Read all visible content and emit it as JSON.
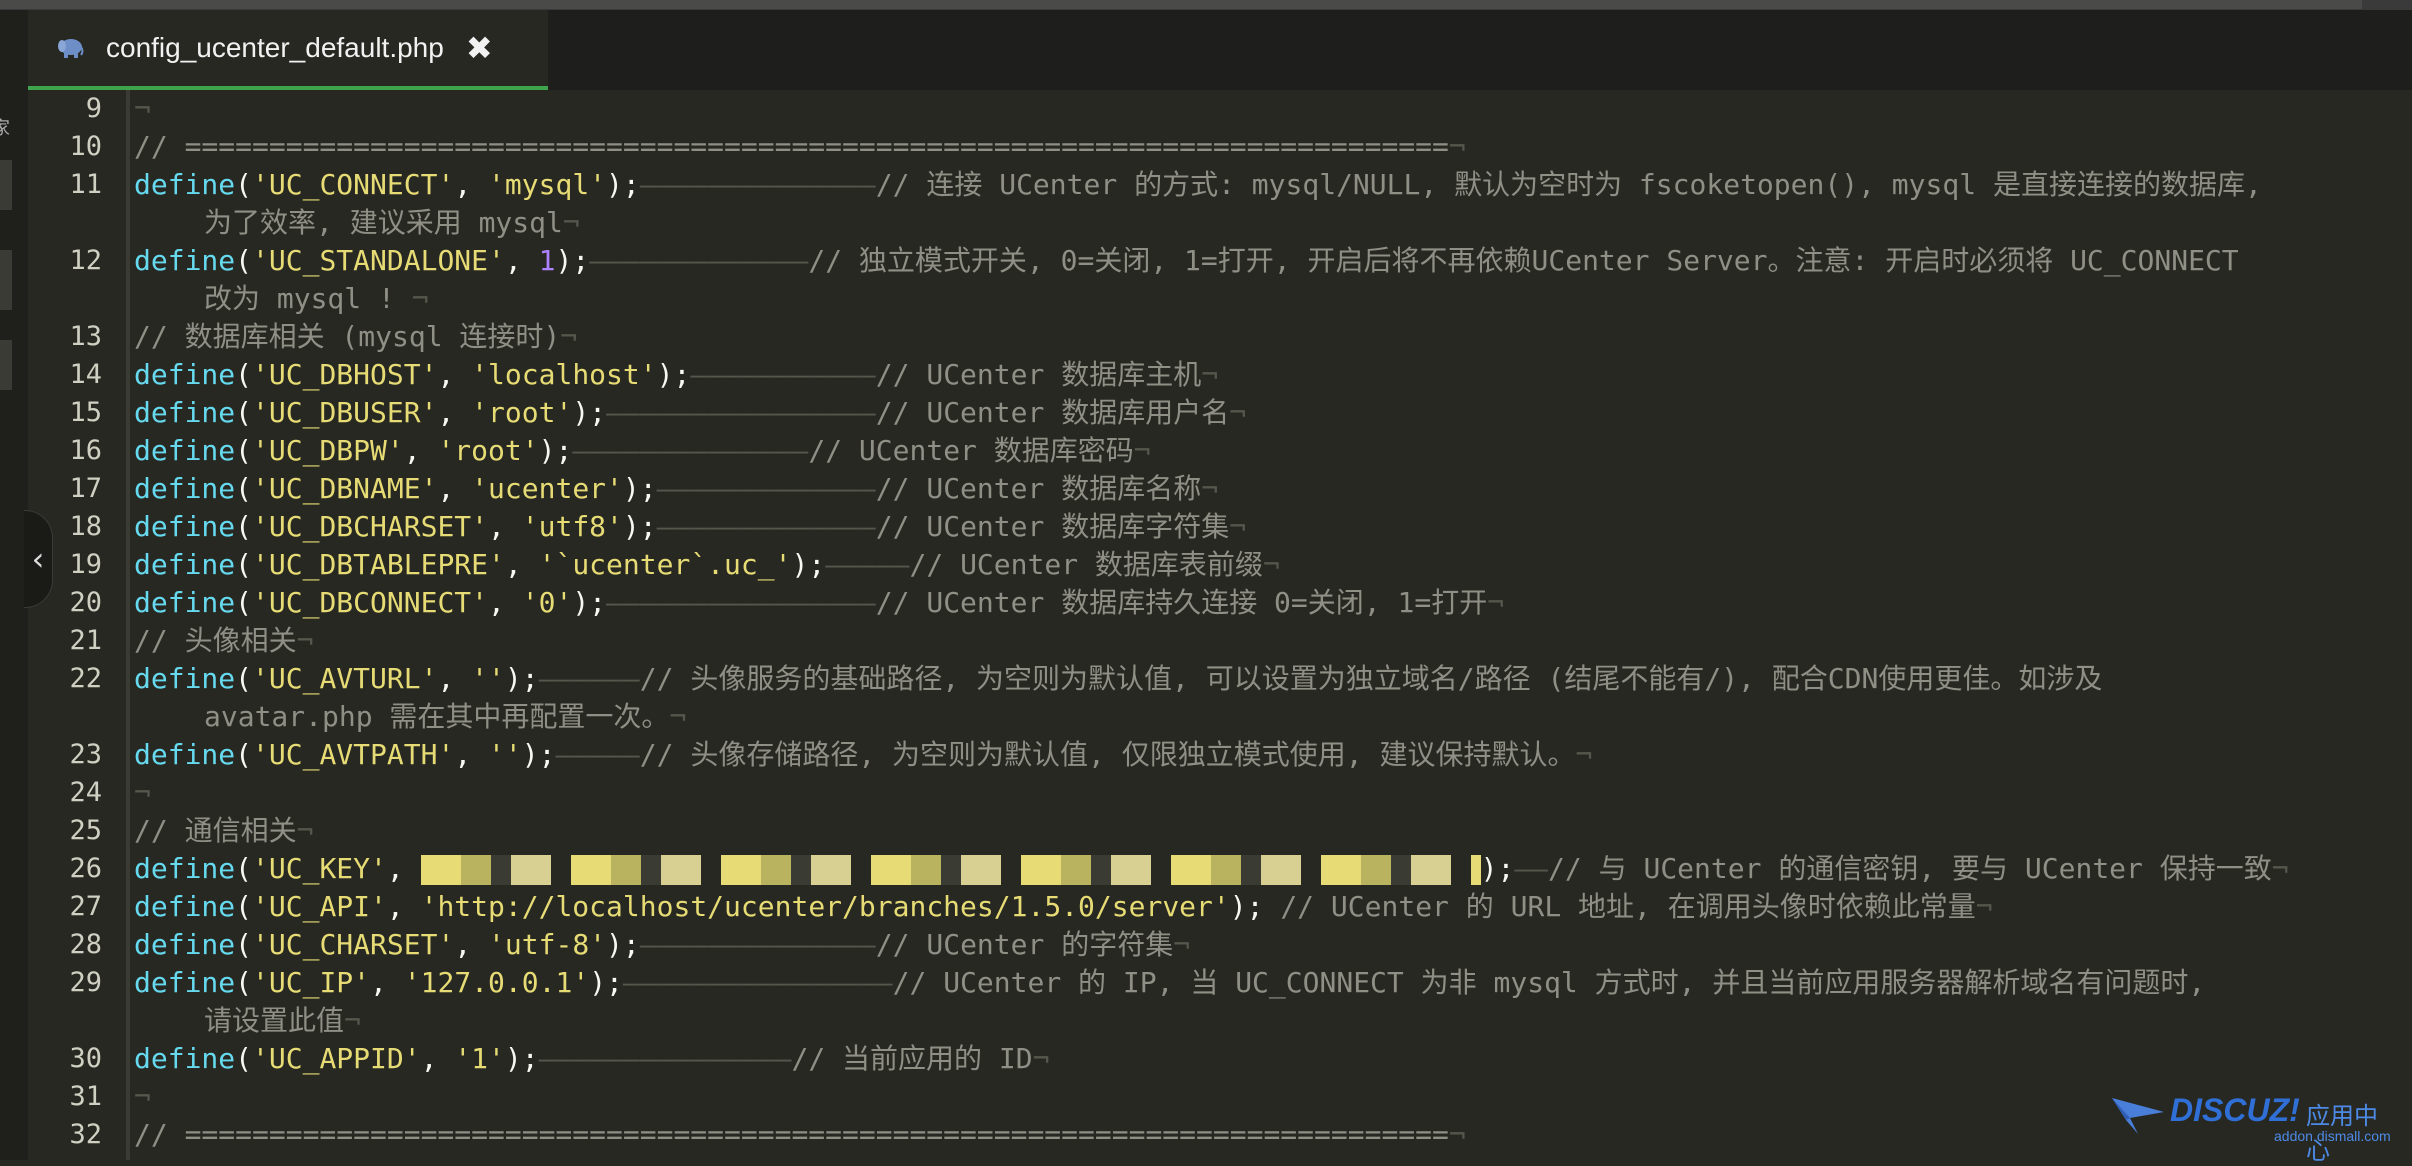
{
  "tab": {
    "title": "config_ucenter_default.php",
    "close_glyph": "✖",
    "icon": "php-elephant-icon"
  },
  "sidebar": {
    "collapse_glyph": "‹",
    "edge_glyph": "家"
  },
  "colors": {
    "keyword": "#66d9ef",
    "string": "#e6db74",
    "number": "#ae81ff",
    "comment": "#8f8f86",
    "background": "#272822",
    "tab_accent": "#3ea34a"
  },
  "lines": [
    {
      "num": "9",
      "tokens": [
        {
          "t": "nl",
          "v": "¬"
        }
      ]
    },
    {
      "num": "10",
      "tokens": [
        {
          "t": "c",
          "v": "// ==========================================================================="
        },
        {
          "t": "nl",
          "v": "¬"
        }
      ]
    },
    {
      "num": "11",
      "tokens": [
        {
          "t": "k",
          "v": "define"
        },
        {
          "t": "p",
          "v": "("
        },
        {
          "t": "s",
          "v": "'UC_CONNECT'"
        },
        {
          "t": "p",
          "v": ", "
        },
        {
          "t": "s",
          "v": "'mysql'"
        },
        {
          "t": "p",
          "v": ");"
        },
        {
          "t": "dash",
          "v": "——————————————"
        },
        {
          "t": "c",
          "v": "// 连接 UCenter 的方式: mysql/NULL, 默认为空时为 fscoketopen(), mysql 是直接连接的数据库,"
        }
      ],
      "cont": [
        {
          "t": "c",
          "v": "为了效率, 建议采用 mysql"
        },
        {
          "t": "nl",
          "v": "¬"
        }
      ]
    },
    {
      "num": "12",
      "tokens": [
        {
          "t": "k",
          "v": "define"
        },
        {
          "t": "p",
          "v": "("
        },
        {
          "t": "s",
          "v": "'UC_STANDALONE'"
        },
        {
          "t": "p",
          "v": ", "
        },
        {
          "t": "n",
          "v": "1"
        },
        {
          "t": "p",
          "v": ");"
        },
        {
          "t": "dash",
          "v": "—————————————"
        },
        {
          "t": "c",
          "v": "// 独立模式开关, 0=关闭, 1=打开, 开启后将不再依赖UCenter Server。注意: 开启时必须将 UC_CONNECT"
        }
      ],
      "cont": [
        {
          "t": "c",
          "v": "改为 mysql ! "
        },
        {
          "t": "nl",
          "v": "¬"
        }
      ]
    },
    {
      "num": "13",
      "tokens": [
        {
          "t": "c",
          "v": "// 数据库相关 (mysql 连接时)"
        },
        {
          "t": "nl",
          "v": "¬"
        }
      ]
    },
    {
      "num": "14",
      "tokens": [
        {
          "t": "k",
          "v": "define"
        },
        {
          "t": "p",
          "v": "("
        },
        {
          "t": "s",
          "v": "'UC_DBHOST'"
        },
        {
          "t": "p",
          "v": ", "
        },
        {
          "t": "s",
          "v": "'localhost'"
        },
        {
          "t": "p",
          "v": ");"
        },
        {
          "t": "dash",
          "v": "———————————"
        },
        {
          "t": "c",
          "v": "// UCenter 数据库主机"
        },
        {
          "t": "nl",
          "v": "¬"
        }
      ]
    },
    {
      "num": "15",
      "tokens": [
        {
          "t": "k",
          "v": "define"
        },
        {
          "t": "p",
          "v": "("
        },
        {
          "t": "s",
          "v": "'UC_DBUSER'"
        },
        {
          "t": "p",
          "v": ", "
        },
        {
          "t": "s",
          "v": "'root'"
        },
        {
          "t": "p",
          "v": ");"
        },
        {
          "t": "dash",
          "v": "————————————————"
        },
        {
          "t": "c",
          "v": "// UCenter 数据库用户名"
        },
        {
          "t": "nl",
          "v": "¬"
        }
      ]
    },
    {
      "num": "16",
      "tokens": [
        {
          "t": "k",
          "v": "define"
        },
        {
          "t": "p",
          "v": "("
        },
        {
          "t": "s",
          "v": "'UC_DBPW'"
        },
        {
          "t": "p",
          "v": ", "
        },
        {
          "t": "s",
          "v": "'root'"
        },
        {
          "t": "p",
          "v": ");"
        },
        {
          "t": "dash",
          "v": "——————————————"
        },
        {
          "t": "c",
          "v": "// UCenter 数据库密码"
        },
        {
          "t": "nl",
          "v": "¬"
        }
      ]
    },
    {
      "num": "17",
      "tokens": [
        {
          "t": "k",
          "v": "define"
        },
        {
          "t": "p",
          "v": "("
        },
        {
          "t": "s",
          "v": "'UC_DBNAME'"
        },
        {
          "t": "p",
          "v": ", "
        },
        {
          "t": "s",
          "v": "'ucenter'"
        },
        {
          "t": "p",
          "v": ");"
        },
        {
          "t": "dash",
          "v": "—————————————"
        },
        {
          "t": "c",
          "v": "// UCenter 数据库名称"
        },
        {
          "t": "nl",
          "v": "¬"
        }
      ]
    },
    {
      "num": "18",
      "tokens": [
        {
          "t": "k",
          "v": "define"
        },
        {
          "t": "p",
          "v": "("
        },
        {
          "t": "s",
          "v": "'UC_DBCHARSET'"
        },
        {
          "t": "p",
          "v": ", "
        },
        {
          "t": "s",
          "v": "'utf8'"
        },
        {
          "t": "p",
          "v": ");"
        },
        {
          "t": "dash",
          "v": "—————————————"
        },
        {
          "t": "c",
          "v": "// UCenter 数据库字符集"
        },
        {
          "t": "nl",
          "v": "¬"
        }
      ]
    },
    {
      "num": "19",
      "tokens": [
        {
          "t": "k",
          "v": "define"
        },
        {
          "t": "p",
          "v": "("
        },
        {
          "t": "s",
          "v": "'UC_DBTABLEPRE'"
        },
        {
          "t": "p",
          "v": ", "
        },
        {
          "t": "s",
          "v": "'`ucenter`.uc_'"
        },
        {
          "t": "p",
          "v": ");"
        },
        {
          "t": "dash",
          "v": "—————"
        },
        {
          "t": "c",
          "v": "// UCenter 数据库表前缀"
        },
        {
          "t": "nl",
          "v": "¬"
        }
      ]
    },
    {
      "num": "20",
      "tokens": [
        {
          "t": "k",
          "v": "define"
        },
        {
          "t": "p",
          "v": "("
        },
        {
          "t": "s",
          "v": "'UC_DBCONNECT'"
        },
        {
          "t": "p",
          "v": ", "
        },
        {
          "t": "s",
          "v": "'0'"
        },
        {
          "t": "p",
          "v": ");"
        },
        {
          "t": "dash",
          "v": "————————————————"
        },
        {
          "t": "c",
          "v": "// UCenter 数据库持久连接 0=关闭, 1=打开"
        },
        {
          "t": "nl",
          "v": "¬"
        }
      ]
    },
    {
      "num": "21",
      "tokens": [
        {
          "t": "c",
          "v": "// 头像相关"
        },
        {
          "t": "nl",
          "v": "¬"
        }
      ]
    },
    {
      "num": "22",
      "tokens": [
        {
          "t": "k",
          "v": "define"
        },
        {
          "t": "p",
          "v": "("
        },
        {
          "t": "s",
          "v": "'UC_AVTURL'"
        },
        {
          "t": "p",
          "v": ", "
        },
        {
          "t": "s",
          "v": "''"
        },
        {
          "t": "p",
          "v": ");"
        },
        {
          "t": "dash",
          "v": "——————"
        },
        {
          "t": "c",
          "v": "// 头像服务的基础路径, 为空则为默认值, 可以设置为独立域名/路径 (结尾不能有/), 配合CDN使用更佳。如涉及"
        }
      ],
      "cont": [
        {
          "t": "c",
          "v": "avatar.php 需在其中再配置一次。"
        },
        {
          "t": "nl",
          "v": "¬"
        }
      ]
    },
    {
      "num": "23",
      "tokens": [
        {
          "t": "k",
          "v": "define"
        },
        {
          "t": "p",
          "v": "("
        },
        {
          "t": "s",
          "v": "'UC_AVTPATH'"
        },
        {
          "t": "p",
          "v": ", "
        },
        {
          "t": "s",
          "v": "''"
        },
        {
          "t": "p",
          "v": ");"
        },
        {
          "t": "dash",
          "v": "—————"
        },
        {
          "t": "c",
          "v": "// 头像存储路径, 为空则为默认值, 仅限独立模式使用, 建议保持默认。"
        },
        {
          "t": "nl",
          "v": "¬"
        }
      ]
    },
    {
      "num": "24",
      "tokens": [
        {
          "t": "nl",
          "v": "¬"
        }
      ]
    },
    {
      "num": "25",
      "tokens": [
        {
          "t": "c",
          "v": "// 通信相关"
        },
        {
          "t": "nl",
          "v": "¬"
        }
      ]
    },
    {
      "num": "26",
      "tokens": [
        {
          "t": "k",
          "v": "define"
        },
        {
          "t": "p",
          "v": "("
        },
        {
          "t": "s",
          "v": "'UC_KEY'"
        },
        {
          "t": "p",
          "v": ", "
        },
        {
          "t": "blur",
          "v": ""
        },
        {
          "t": "p",
          "v": ");"
        },
        {
          "t": "dash",
          "v": "——"
        },
        {
          "t": "c",
          "v": "// 与 UCenter 的通信密钥, 要与 UCenter 保持一致"
        },
        {
          "t": "nl",
          "v": "¬"
        }
      ]
    },
    {
      "num": "27",
      "tokens": [
        {
          "t": "k",
          "v": "define"
        },
        {
          "t": "p",
          "v": "("
        },
        {
          "t": "s",
          "v": "'UC_API'"
        },
        {
          "t": "p",
          "v": ", "
        },
        {
          "t": "s",
          "v": "'http://localhost/ucenter/branches/1.5.0/server'"
        },
        {
          "t": "p",
          "v": "); "
        },
        {
          "t": "c",
          "v": "// UCenter 的 URL 地址, 在调用头像时依赖此常量"
        },
        {
          "t": "nl",
          "v": "¬"
        }
      ]
    },
    {
      "num": "28",
      "tokens": [
        {
          "t": "k",
          "v": "define"
        },
        {
          "t": "p",
          "v": "("
        },
        {
          "t": "s",
          "v": "'UC_CHARSET'"
        },
        {
          "t": "p",
          "v": ", "
        },
        {
          "t": "s",
          "v": "'utf-8'"
        },
        {
          "t": "p",
          "v": ");"
        },
        {
          "t": "dash",
          "v": "——————————————"
        },
        {
          "t": "c",
          "v": "// UCenter 的字符集"
        },
        {
          "t": "nl",
          "v": "¬"
        }
      ]
    },
    {
      "num": "29",
      "tokens": [
        {
          "t": "k",
          "v": "define"
        },
        {
          "t": "p",
          "v": "("
        },
        {
          "t": "s",
          "v": "'UC_IP'"
        },
        {
          "t": "p",
          "v": ", "
        },
        {
          "t": "s",
          "v": "'127.0.0.1'"
        },
        {
          "t": "p",
          "v": ");"
        },
        {
          "t": "dash",
          "v": "————————————————"
        },
        {
          "t": "c",
          "v": "// UCenter 的 IP, 当 UC_CONNECT 为非 mysql 方式时, 并且当前应用服务器解析域名有问题时,"
        }
      ],
      "cont": [
        {
          "t": "c",
          "v": "请设置此值"
        },
        {
          "t": "nl",
          "v": "¬"
        }
      ]
    },
    {
      "num": "30",
      "tokens": [
        {
          "t": "k",
          "v": "define"
        },
        {
          "t": "p",
          "v": "("
        },
        {
          "t": "s",
          "v": "'UC_APPID'"
        },
        {
          "t": "p",
          "v": ", "
        },
        {
          "t": "s",
          "v": "'1'"
        },
        {
          "t": "p",
          "v": ");"
        },
        {
          "t": "dash",
          "v": "———————————————"
        },
        {
          "t": "c",
          "v": "// 当前应用的 ID"
        },
        {
          "t": "nl",
          "v": "¬"
        }
      ]
    },
    {
      "num": "31",
      "tokens": [
        {
          "t": "nl",
          "v": "¬"
        }
      ]
    },
    {
      "num": "32",
      "tokens": [
        {
          "t": "c",
          "v": "// ==========================================================================="
        },
        {
          "t": "nl",
          "v": "¬"
        }
      ]
    }
  ],
  "watermark": {
    "brand": "DISCUZ!",
    "cn": "应用中心",
    "url": "addon.dismall.com"
  }
}
